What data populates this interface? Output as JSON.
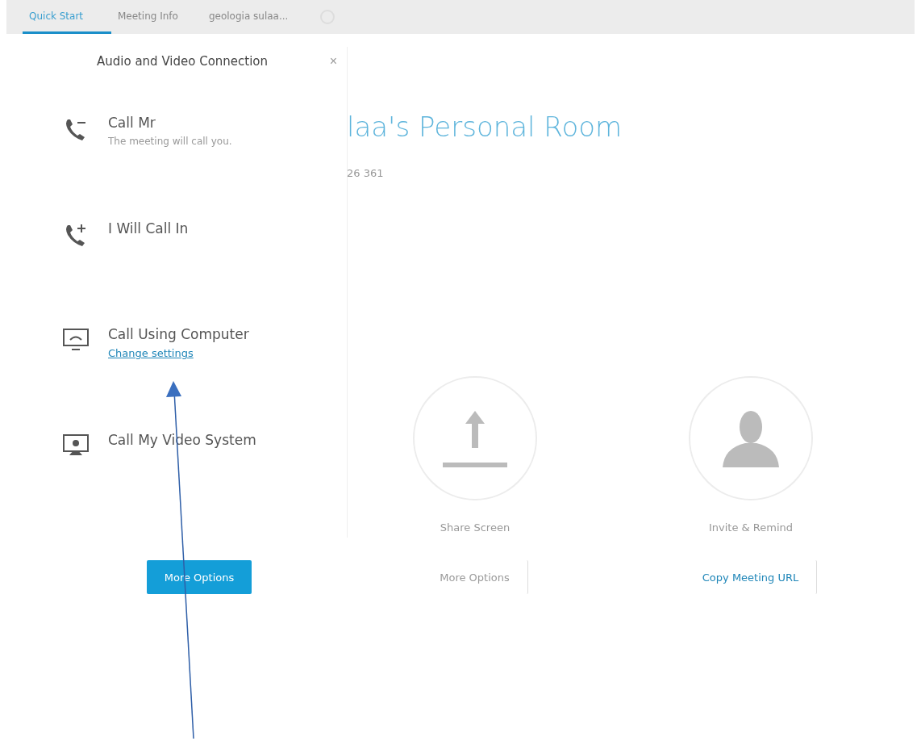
{
  "tabs": [
    {
      "label": "Quick Start",
      "selected": true
    },
    {
      "label": "Meeting Info",
      "selected": false
    },
    {
      "label": "geologia sulaa...",
      "selected": false
    }
  ],
  "room_title": "laa's Personal Room",
  "meeting_number": "26 361",
  "actions": [
    {
      "kind": "hidden",
      "button": "More Options"
    },
    {
      "kind": "share",
      "label": "Share Screen",
      "button": "More Options"
    },
    {
      "kind": "invite",
      "label": "Invite & Remind",
      "button": "Copy Meeting URL"
    }
  ],
  "panel": {
    "title": "Audio and Video Connection",
    "close": "×",
    "options": [
      {
        "kind": "call-me",
        "label": "Call Mr",
        "sublabel": "The meeting will call you."
      },
      {
        "kind": "call-in",
        "label": "I Will Call In"
      },
      {
        "kind": "computer",
        "label": "Call Using Computer",
        "link": "Change settings"
      },
      {
        "kind": "video-system",
        "label": "Call My Video System"
      }
    ]
  }
}
